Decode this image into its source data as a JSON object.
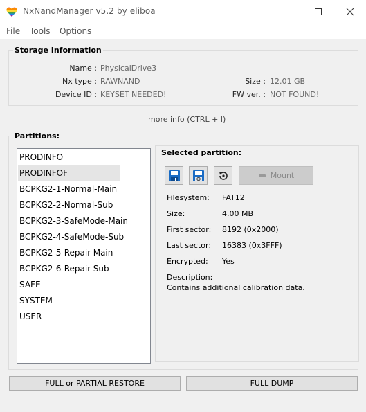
{
  "window": {
    "title": "NxNandManager v5.2 by eliboa"
  },
  "menu": {
    "items": [
      "File",
      "Tools",
      "Options"
    ]
  },
  "storage": {
    "title": "Storage Information",
    "name_label": "Name :",
    "name_value": "PhysicalDrive3",
    "nxtype_label": "Nx type :",
    "nxtype_value": "RAWNAND",
    "deviceid_label": "Device ID :",
    "deviceid_value": "KEYSET NEEDED!",
    "size_label": "Size :",
    "size_value": "12.01 GB",
    "fwver_label": "FW ver. :",
    "fwver_value": "NOT FOUND!"
  },
  "more_info": "more info (CTRL + I)",
  "partitions": {
    "title": "Partitions:",
    "items": [
      "PRODINFO",
      "PRODINFOF",
      "BCPKG2-1-Normal-Main",
      "BCPKG2-2-Normal-Sub",
      "BCPKG2-3-SafeMode-Main",
      "BCPKG2-4-SafeMode-Sub",
      "BCPKG2-5-Repair-Main",
      "BCPKG2-6-Repair-Sub",
      "SAFE",
      "SYSTEM",
      "USER"
    ],
    "selected": "PRODINFOF"
  },
  "selected_partition": {
    "title": "Selected partition:",
    "mount_label": "Mount",
    "filesystem_label": "Filesystem:",
    "filesystem_value": "FAT12",
    "size_label": "Size:",
    "size_value": "4.00 MB",
    "first_sector_label": "First sector:",
    "first_sector_value": "8192 (0x2000)",
    "last_sector_label": "Last sector:",
    "last_sector_value": "16383 (0x3FFF)",
    "encrypted_label": "Encrypted:",
    "encrypted_value": "Yes",
    "description_label": "Description:",
    "description_value": "Contains additional calibration data."
  },
  "actions": {
    "restore_label": "FULL or PARTIAL RESTORE",
    "dump_label": "FULL DUMP"
  },
  "colors": {
    "window_bg": "#f0f0f0",
    "save_icon_blue": "#1a6bc4",
    "selected_row": "#e5e5e5"
  },
  "icons": [
    "heart-app-icon",
    "minimize-icon",
    "maximize-icon",
    "close-icon",
    "save-icon",
    "save-encrypted-icon",
    "restore-icon",
    "mount-icon"
  ]
}
